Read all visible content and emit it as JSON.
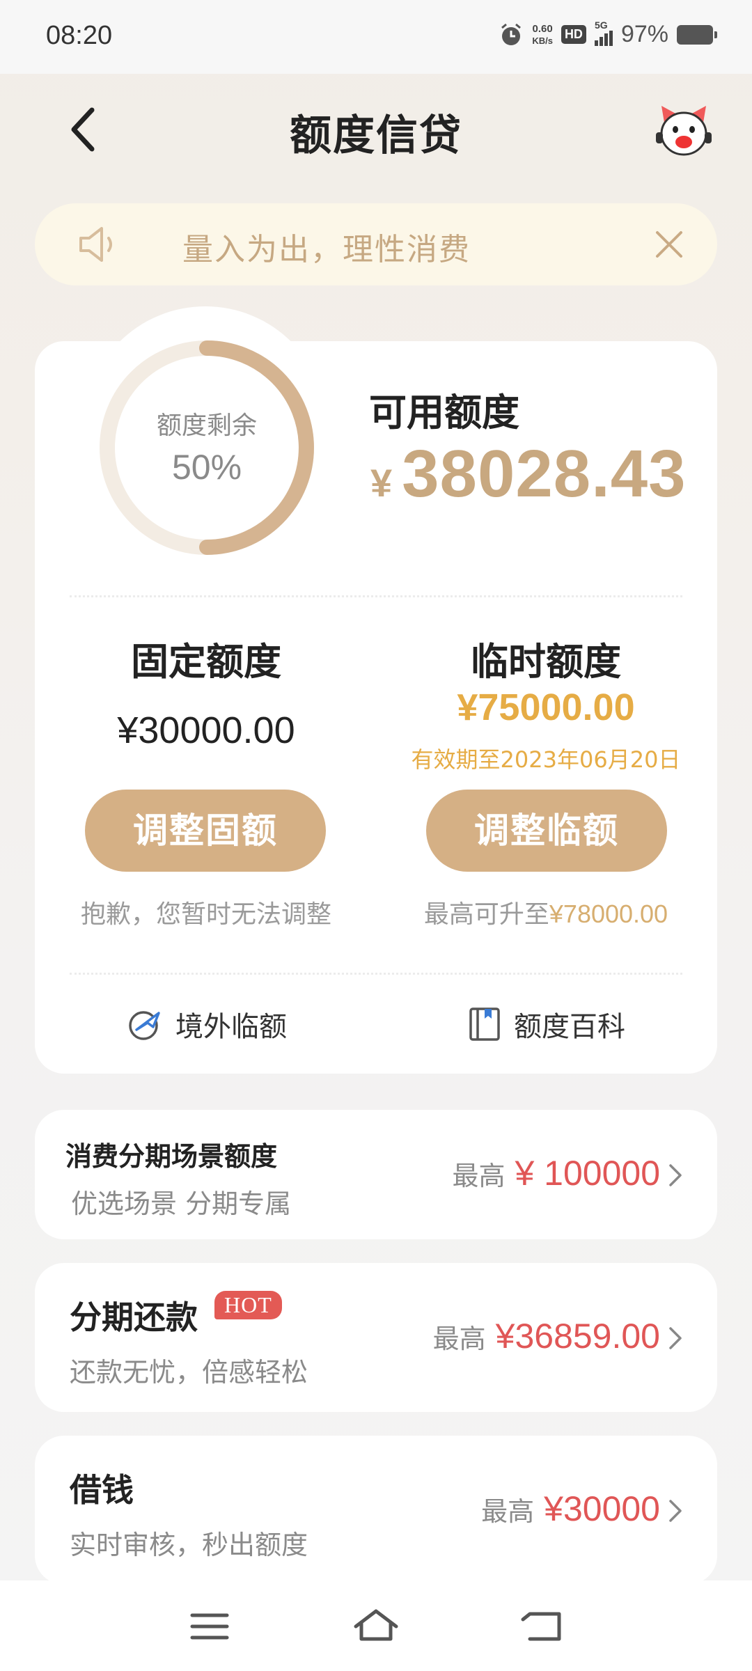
{
  "status_bar": {
    "time": "08:20",
    "speed_value": "0.60",
    "speed_unit": "KB/s",
    "hd": "HD",
    "network": "5G",
    "battery": "97%"
  },
  "header": {
    "title": "额度信贷"
  },
  "notice": {
    "text": "量入为出，理性消费"
  },
  "credit": {
    "remaining_label": "额度剩余",
    "remaining_percent": "50%",
    "remaining_fraction": 0.5,
    "available_label": "可用额度",
    "currency": "¥",
    "available_amount": "38028.43"
  },
  "fixed": {
    "title": "固定额度",
    "amount": "¥30000.00",
    "button": "调整固额",
    "note": "抱歉，您暂时无法调整"
  },
  "temporary": {
    "title": "临时额度",
    "amount": "¥75000.00",
    "expiry": "有效期至2023年06月20日",
    "button": "调整临额",
    "note_prefix": "最高可升至",
    "note_amount": "¥78000.00"
  },
  "links": {
    "overseas": "境外临额",
    "encyclopedia": "额度百科"
  },
  "rows": [
    {
      "title": "消费分期场景额度",
      "subtitle": "优选场景 分期专属",
      "prefix": "最高",
      "value": "¥ 100000"
    },
    {
      "title": "分期还款",
      "badge": "HOT",
      "subtitle": "还款无忧，倍感轻松",
      "prefix": "最高",
      "value": "¥36859.00"
    },
    {
      "title": "借钱",
      "subtitle": "实时审核，秒出额度",
      "prefix": "最高",
      "value": "¥30000"
    }
  ],
  "colors": {
    "accent_gold": "#d5b085",
    "highlight_yellow": "#e6ac45",
    "value_red": "#e05656"
  }
}
